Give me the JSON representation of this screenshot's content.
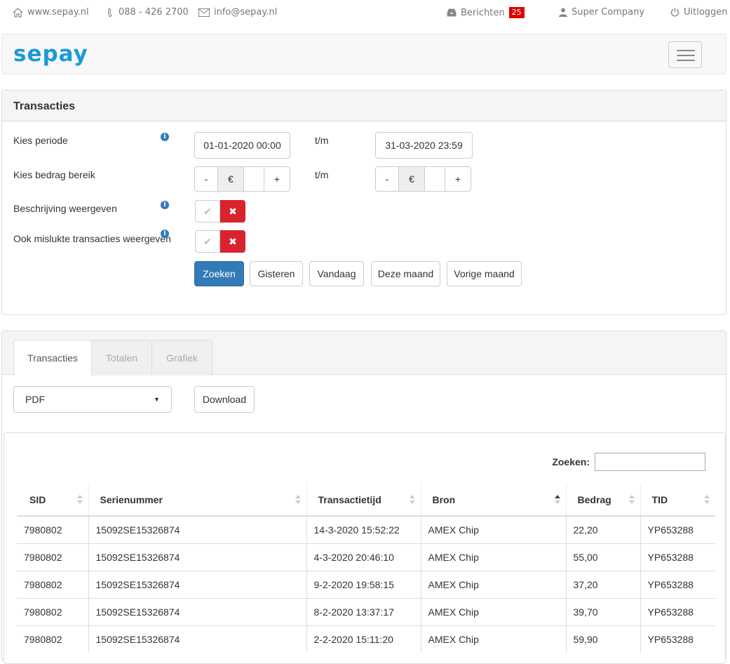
{
  "topbar": {
    "website": "www.sepay.nl",
    "phone": "088 - 426 2700",
    "email": "info@sepay.nl",
    "messages_label": "Berichten",
    "messages_count": "25",
    "user": "Super Company",
    "logout": "Uitloggen"
  },
  "navbar": {
    "logo": "sepay"
  },
  "filter": {
    "title": "Transacties",
    "period_label": "Kies periode",
    "amount_label": "Kies bedrag bereik",
    "description_label": "Beschrijving weergeven",
    "failed_label": "Ook mislukte transacties weergeven",
    "tm": "t/m",
    "date_from": "01-01-2020 00:00",
    "date_to": "31-03-2020 23:59",
    "minus": "-",
    "plus": "+",
    "currency": "€",
    "check": "✔",
    "cross": "✖",
    "buttons": {
      "search": "Zoeken",
      "yesterday": "Gisteren",
      "today": "Vandaag",
      "this_month": "Deze maand",
      "last_month": "Vorige maand"
    }
  },
  "results": {
    "tabs": [
      "Transacties",
      "Totalen",
      "Grafiek"
    ],
    "format": "PDF",
    "download": "Download",
    "search_label": "Zoeken:",
    "columns": [
      "SID",
      "Serienummer",
      "Transactietijd",
      "Bron",
      "Bedrag",
      "TID"
    ],
    "rows": [
      [
        "7980802",
        "15092SE15326874",
        "14-3-2020 15:52:22",
        "AMEX Chip",
        "22,20",
        "YP653288"
      ],
      [
        "7980802",
        "15092SE15326874",
        "4-3-2020 20:46:10",
        "AMEX Chip",
        "55,00",
        "YP653288"
      ],
      [
        "7980802",
        "15092SE15326874",
        "9-2-2020 19:58:15",
        "AMEX Chip",
        "37,20",
        "YP653288"
      ],
      [
        "7980802",
        "15092SE15326874",
        "8-2-2020 13:37:17",
        "AMEX Chip",
        "39,70",
        "YP653288"
      ],
      [
        "7980802",
        "15092SE15326874",
        "2-2-2020 15:11:20",
        "AMEX Chip",
        "59,90",
        "YP653288"
      ]
    ]
  },
  "colors": {
    "brand": "#1a9ad7",
    "primary": "#337ab7",
    "danger": "#d9232e"
  }
}
